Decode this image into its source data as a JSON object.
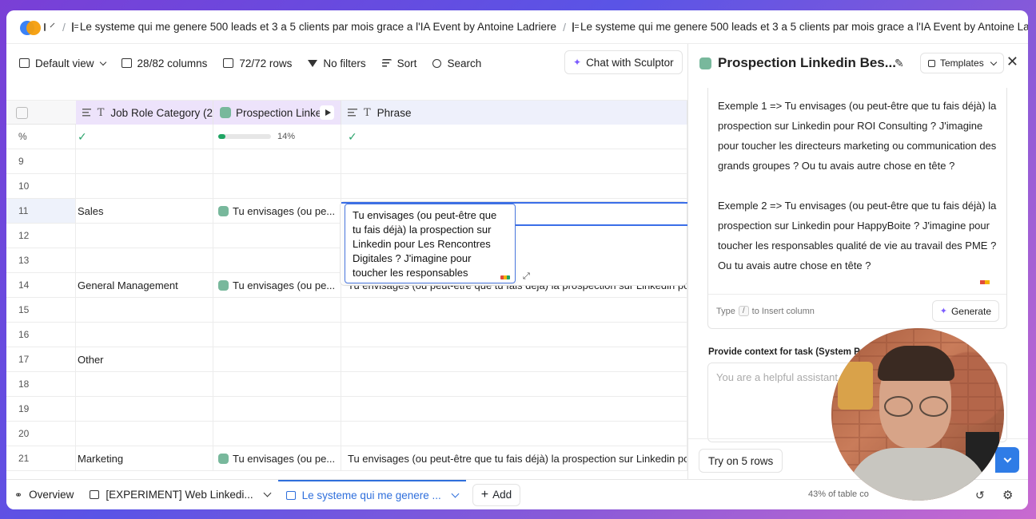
{
  "breadcrumb": {
    "items": [
      "Le systeme qui me genere 500 leads et 3 a 5 clients par mois grace a l'IA Event by Antoine Ladriere",
      "Le systeme qui me genere 500 leads et 3 a 5 clients par mois grace a l'IA Event by Antoine Ladriere"
    ]
  },
  "toolbar": {
    "default_view": "Default view",
    "columns": "28/82 columns",
    "rows": "72/72 rows",
    "filters": "No filters",
    "sort": "Sort",
    "search": "Search",
    "chat": "Chat with Sculptor"
  },
  "grid": {
    "headers": {
      "job_role": "Job Role Category (2",
      "prospection": "Prospection Linke",
      "phrase": "Phrase"
    },
    "percent_row": {
      "label": "%",
      "prospection_percent_text": "14%",
      "prospection_progress": 0.14
    },
    "rows": [
      {
        "n": "9",
        "job": "",
        "prospection": "",
        "phrase": ""
      },
      {
        "n": "10",
        "job": "",
        "prospection": "",
        "phrase": ""
      },
      {
        "n": "11",
        "job": "Sales",
        "prospection": "Tu envisages (ou pe...",
        "phrase": ""
      },
      {
        "n": "12",
        "job": "",
        "prospection": "",
        "phrase": ""
      },
      {
        "n": "13",
        "job": "",
        "prospection": "",
        "phrase": ""
      },
      {
        "n": "14",
        "job": "General Management",
        "prospection": "Tu envisages (ou pe...",
        "phrase": "Tu envisages (ou peut-être que tu fais déjà) la prospection sur Linkedin po"
      },
      {
        "n": "15",
        "job": "",
        "prospection": "",
        "phrase": ""
      },
      {
        "n": "16",
        "job": "",
        "prospection": "",
        "phrase": ""
      },
      {
        "n": "17",
        "job": "Other",
        "prospection": "",
        "phrase": ""
      },
      {
        "n": "18",
        "job": "",
        "prospection": "",
        "phrase": ""
      },
      {
        "n": "19",
        "job": "",
        "prospection": "",
        "phrase": ""
      },
      {
        "n": "20",
        "job": "",
        "prospection": "",
        "phrase": ""
      },
      {
        "n": "21",
        "job": "Marketing",
        "prospection": "Tu envisages (ou pe...",
        "phrase": "Tu envisages (ou peut-être que tu fais déjà) la prospection sur Linkedin po"
      }
    ],
    "editor_text": "Tu envisages (ou peut-être que tu fais déjà) la prospection sur Linkedin pour Les Rencontres Digitales ? J'imagine pour toucher les responsables"
  },
  "panel": {
    "title": "Prospection Linkedin Bes...",
    "templates": "Templates",
    "prompt_paragraphs": [
      "Exemple 1 => Tu envisages (ou peut-être que tu fais déjà) la prospection sur Linkedin pour ROI Consulting ? J'imagine pour toucher les directeurs marketing ou communication des grands groupes ? Ou tu avais autre chose en tête ?",
      "Exemple 2 => Tu envisages (ou peut-être que tu fais déjà) la prospection sur Linkedin pour HappyBoite ? J'imagine pour toucher les responsables qualité de vie au travail des PME ? Ou tu avais autre chose en tête ?"
    ],
    "hint_type": "Type",
    "hint_key": "/",
    "hint_rest": "to Insert column",
    "generate": "Generate",
    "context_label": "Provide context for task (System Prom",
    "context_placeholder": "You are a helpful assistant",
    "try_button": "Try on 5 rows"
  },
  "bottom_tabs": {
    "overview": "Overview",
    "experiment": "[EXPERIMENT] Web Linkedi...",
    "current": "Le systeme qui me genere ...",
    "add": "Add",
    "coverage": "43% of table co"
  },
  "colors": {
    "accent_blue": "#2f6fdc",
    "progress_green": "#1fa463",
    "header_purple": "#ede3fb"
  }
}
